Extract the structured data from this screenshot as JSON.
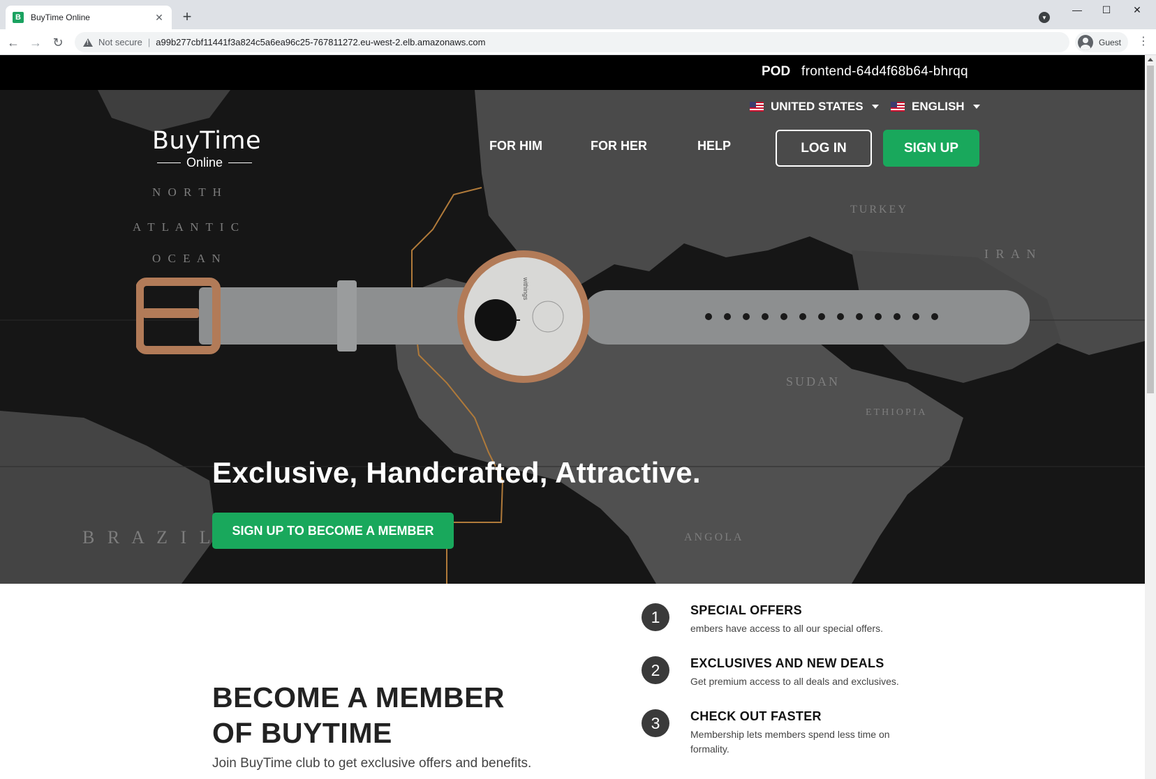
{
  "browser": {
    "tab_title": "BuyTime Online",
    "favicon_letter": "B",
    "security_label": "Not secure",
    "url": "a99b277cbf11441f3a824c5a6ea96c25-767811272.eu-west-2.elb.amazonaws.com",
    "profile_label": "Guest"
  },
  "pod": {
    "label": "POD",
    "value": "frontend-64d4f68b64-bhrqq"
  },
  "header": {
    "country": "UNITED STATES",
    "language": "ENGLISH",
    "logo_main": "BuyTime",
    "logo_sub": "Online",
    "nav": [
      "FOR HIM",
      "FOR HER",
      "HELP"
    ],
    "login_label": "LOG IN",
    "signup_label": "SIGN UP"
  },
  "hero": {
    "title": "Exclusive, Handcrafted, Attractive.",
    "cta_label": "SIGN UP TO BECOME A MEMBER",
    "watch_brand": "withings"
  },
  "membership": {
    "title_line1": "BECOME A MEMBER",
    "title_line2": "OF BUYTIME",
    "subtitle": "Join BuyTime club to get exclusive offers and benefits.",
    "benefits": [
      {
        "number": "1",
        "title": "SPECIAL OFFERS",
        "desc": "embers have access to all our special offers."
      },
      {
        "number": "2",
        "title": "EXCLUSIVES AND NEW DEALS",
        "desc": "Get premium access to all deals and exclusives."
      },
      {
        "number": "3",
        "title": "CHECK OUT FASTER",
        "desc": "Membership lets members spend less time on formality."
      }
    ]
  },
  "icons": {
    "tab_close": "close-icon",
    "new_tab": "plus-icon",
    "back": "arrow-left-icon",
    "forward": "arrow-right-icon",
    "reload": "reload-icon",
    "security": "warning-icon",
    "profile": "account-icon",
    "menu": "kebab-menu-icon",
    "flag": "us-flag-icon",
    "caret": "caret-down-icon"
  },
  "colors": {
    "accent_green": "#19a85c",
    "pod_bar": "#000000",
    "hero_bg": "#161616"
  }
}
